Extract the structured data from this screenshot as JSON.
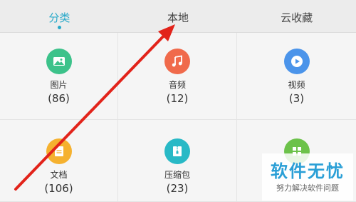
{
  "tabs": [
    {
      "label": "分类",
      "active": true
    },
    {
      "label": "本地",
      "active": false
    },
    {
      "label": "云收藏",
      "active": false
    }
  ],
  "categories": [
    {
      "label": "图片",
      "count": "(86)",
      "icon": "image-icon",
      "color": "#3cc28a"
    },
    {
      "label": "音频",
      "count": "(12)",
      "icon": "music-icon",
      "color": "#f06a4b"
    },
    {
      "label": "视频",
      "count": "(3)",
      "icon": "play-icon",
      "color": "#4b94ea"
    },
    {
      "label": "文档",
      "count": "(106)",
      "icon": "document-icon",
      "color": "#f5b12f"
    },
    {
      "label": "压缩包",
      "count": "(23)",
      "icon": "archive-icon",
      "color": "#28b9c6"
    },
    {
      "label": "",
      "count": "",
      "icon": "apps-icon",
      "color": "#6cc24a"
    }
  ],
  "watermark": {
    "title": "软件无忧",
    "subtitle": "努力解决软件问题"
  },
  "colors": {
    "accent": "#29a9c9",
    "arrow": "#e2231a"
  }
}
